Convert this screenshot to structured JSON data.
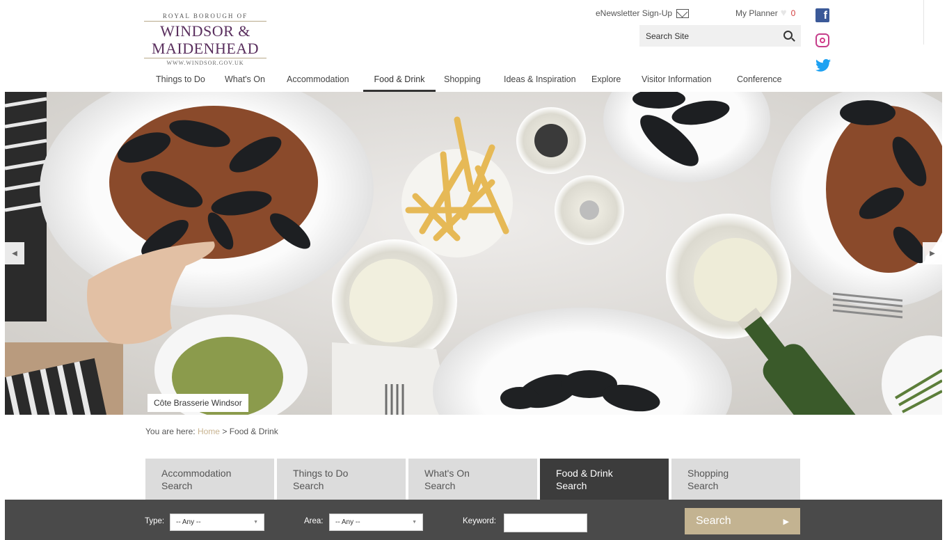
{
  "logo": {
    "line1": "ROYAL BOROUGH OF",
    "line2": "WINDSOR &",
    "line3": "MAIDENHEAD",
    "line4": "WWW.WINDSOR.GOV.UK"
  },
  "header": {
    "enewsletter_label": "eNewsletter Sign-Up",
    "planner_label": "My Planner",
    "planner_count": "0",
    "search_placeholder": "Search Site"
  },
  "social": {
    "facebook_glyph": "f",
    "twitter_glyph": "🐦"
  },
  "nav": [
    {
      "label": "Things to Do"
    },
    {
      "label": "What's On"
    },
    {
      "label": "Accommodation"
    },
    {
      "label": "Food & Drink",
      "active": true
    },
    {
      "label": "Shopping"
    },
    {
      "label": "Ideas & Inspiration"
    },
    {
      "label": "Explore"
    },
    {
      "label": "Visitor Information"
    },
    {
      "label": "Conference"
    }
  ],
  "hero": {
    "caption": "Côte Brasserie Windsor",
    "prev_glyph": "◀",
    "next_glyph": "▶"
  },
  "breadcrumb": {
    "prefix": "You are here:",
    "home": "Home",
    "separator": ">",
    "current": "Food & Drink"
  },
  "tabs": [
    {
      "line1": "Accommodation",
      "line2": "Search"
    },
    {
      "line1": "Things to Do",
      "line2": "Search"
    },
    {
      "line1": "What's On",
      "line2": "Search"
    },
    {
      "line1": "Food & Drink",
      "line2": "Search",
      "active": true
    },
    {
      "line1": "Shopping",
      "line2": "Search"
    }
  ],
  "searchbar": {
    "type_label": "Type:",
    "type_value": "-- Any --",
    "area_label": "Area:",
    "area_value": "-- Any --",
    "keyword_label": "Keyword:",
    "keyword_value": "",
    "button_label": "Search",
    "button_glyph": "▶"
  },
  "colors": {
    "brand_purple": "#5a2f5e",
    "accent_gold": "#c3b391",
    "dark_bar": "#4a4a4a",
    "active_tab": "#3c3c3c",
    "inactive_tab": "#dcdcdc"
  }
}
